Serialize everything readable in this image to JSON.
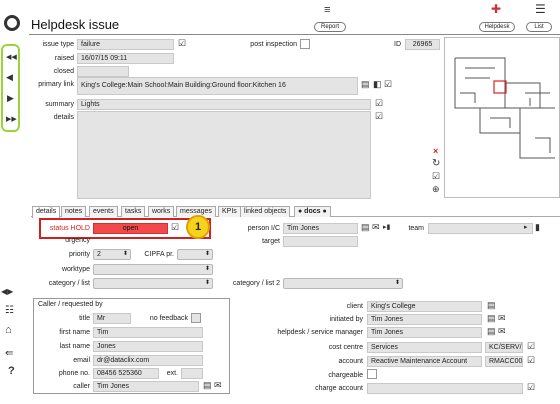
{
  "header": {
    "title": "Helpdesk issue",
    "report_label": "Report",
    "helpdesk_label": "Helpdesk",
    "list_label": "List"
  },
  "issue": {
    "issue_type_label": "issue type",
    "issue_type": "failure",
    "raised_label": "raised",
    "raised": "16/07/15 09:11",
    "closed_label": "closed",
    "closed": "",
    "post_inspection_label": "post inspection",
    "id_label": "ID",
    "id": "26965",
    "primary_link_label": "primary link",
    "primary_link": "King's College:Main School:Main Building:Ground floor:Kitchen 16",
    "summary_label": "summary",
    "summary": "Lights",
    "details_label": "details",
    "details": ""
  },
  "tabs": [
    {
      "label": "details"
    },
    {
      "label": "notes"
    },
    {
      "label": "events"
    },
    {
      "label": "tasks"
    },
    {
      "label": "works"
    },
    {
      "label": "messages"
    },
    {
      "label": "KPIs"
    },
    {
      "label": "linked objects"
    },
    {
      "label": "● docs ●"
    }
  ],
  "status": {
    "status_label": "status HOLD",
    "status_value": "open",
    "callout_number": "1",
    "urgency_label": "urgency",
    "priority_label": "priority",
    "priority_value": "2",
    "cipfa_label": "CIPFA pr.",
    "cipfa_value": "",
    "worktype_label": "worktype",
    "worktype_value": "",
    "category_label": "category / list",
    "category_value": "",
    "category2_label": "category / list 2",
    "category2_value": "",
    "person_ic_label": "person I/C",
    "person_ic": "Tim Jones",
    "target_label": "target",
    "target": "",
    "team_label": "team",
    "team_value": ""
  },
  "caller": {
    "section_label": "Caller / requested by",
    "title_label": "title",
    "title": "Mr",
    "no_feedback_label": "no feedback",
    "first_name_label": "first name",
    "first_name": "Tim",
    "last_name_label": "last name",
    "last_name": "Jones",
    "email_label": "email",
    "email": "dr@dataclix.com",
    "phone_label": "phone no.",
    "phone": "08456 525360",
    "ext_label": "ext.",
    "ext": "",
    "caller_label": "caller",
    "caller": "Tim Jones"
  },
  "client": {
    "client_label": "client",
    "client": "King's College",
    "initiated_label": "initiated by",
    "initiated": "Tim Jones",
    "manager_label": "helpdesk / service manager",
    "manager": "Tim Jones",
    "cost_centre_label": "cost centre",
    "cost_centre": "Services",
    "cost_centre_code": "KC/SERV/",
    "account_label": "account",
    "account": "Reactive Maintenance Account",
    "account_code": "RMACC00",
    "chargeable_label": "chargeable",
    "charge_account_label": "charge account",
    "charge_account": ""
  },
  "colors": {
    "status_red": "#f24a4a",
    "callout_yellow": "#f6d21a",
    "callout_border": "#d02020",
    "nav_green": "#9bd43a"
  }
}
